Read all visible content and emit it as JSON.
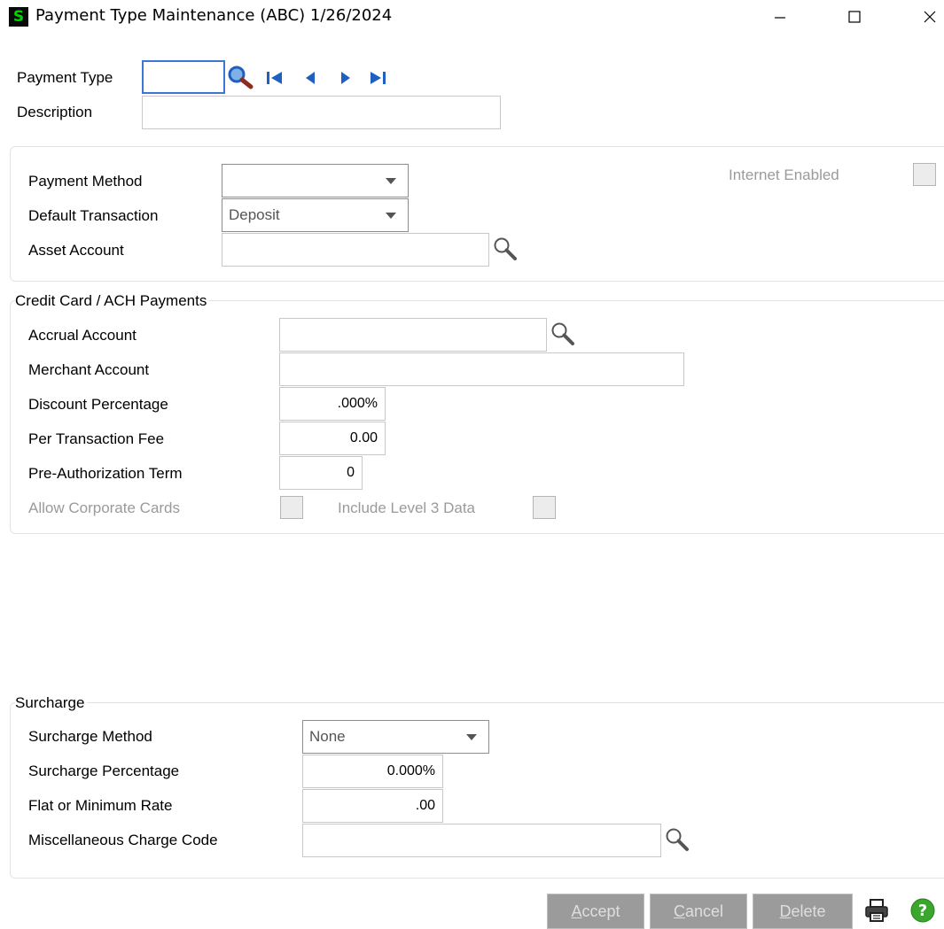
{
  "window": {
    "app_icon_glyph": "S",
    "title": "Payment Type Maintenance (ABC) 1/26/2024"
  },
  "header": {
    "payment_type_label": "Payment Type",
    "payment_type_value": "",
    "description_label": "Description",
    "description_value": ""
  },
  "general": {
    "payment_method_label": "Payment Method",
    "payment_method_value": "",
    "default_transaction_label": "Default Transaction",
    "default_transaction_value": "Deposit",
    "asset_account_label": "Asset Account",
    "asset_account_value": "",
    "internet_enabled_label": "Internet Enabled"
  },
  "credit_card": {
    "group_title": "Credit Card / ACH Payments",
    "accrual_account_label": "Accrual Account",
    "accrual_account_value": "",
    "merchant_account_label": "Merchant Account",
    "merchant_account_value": "",
    "discount_percentage_label": "Discount Percentage",
    "discount_percentage_value": ".000%",
    "per_transaction_fee_label": "Per Transaction Fee",
    "per_transaction_fee_value": "0.00",
    "pre_auth_term_label": "Pre-Authorization Term",
    "pre_auth_term_value": "0",
    "allow_corporate_cards_label": "Allow Corporate Cards",
    "include_level3_label": "Include Level 3 Data"
  },
  "surcharge": {
    "group_title": "Surcharge",
    "method_label": "Surcharge Method",
    "method_value": "None",
    "percentage_label": "Surcharge Percentage",
    "percentage_value": "0.000%",
    "flat_rate_label": "Flat or Minimum Rate",
    "flat_rate_value": ".00",
    "misc_charge_label": "Miscellaneous Charge Code",
    "misc_charge_value": ""
  },
  "buttons": {
    "accept_key": "A",
    "accept_rest": "ccept",
    "cancel_key": "C",
    "cancel_rest": "ancel",
    "delete_key": "D",
    "delete_rest": "elete"
  },
  "colors": {
    "accent_focus": "#3a78d4",
    "disabled_button": "#9b9b9b",
    "help_icon": "#3aa62e"
  }
}
